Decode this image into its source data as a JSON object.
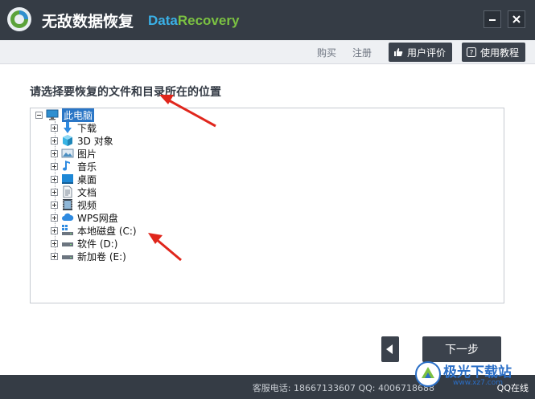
{
  "app": {
    "title": "无敌数据恢复",
    "brand_a": "Data",
    "brand_b": "Recovery"
  },
  "window": {
    "minimize": "—",
    "close": "✕"
  },
  "menu": {
    "buy": "购买",
    "register": "注册",
    "review_btn": "用户评价",
    "tutorial_btn": "使用教程"
  },
  "prompt": "请选择要恢复的文件和目录所在的位置",
  "tree": {
    "root": "此电脑",
    "items": [
      {
        "label": "下载",
        "icon": "download-arrow-icon"
      },
      {
        "label": "3D 对象",
        "icon": "3d-cube-icon"
      },
      {
        "label": "图片",
        "icon": "pictures-icon"
      },
      {
        "label": "音乐",
        "icon": "music-note-icon"
      },
      {
        "label": "桌面",
        "icon": "desktop-icon"
      },
      {
        "label": "文档",
        "icon": "document-icon"
      },
      {
        "label": "视频",
        "icon": "video-icon"
      },
      {
        "label": "WPS网盘",
        "icon": "cloud-icon"
      },
      {
        "label": "本地磁盘 (C:)",
        "icon": "system-drive-icon"
      },
      {
        "label": "软件 (D:)",
        "icon": "drive-icon"
      },
      {
        "label": "新加卷 (E:)",
        "icon": "drive-icon"
      }
    ]
  },
  "buttons": {
    "back": "◀",
    "next": "下一步"
  },
  "footer": {
    "hotline": "客服电话: 18667133607 QQ: 4006718688",
    "qq_online": "QQ在线"
  },
  "watermark": {
    "text": "极光下载站",
    "url": "www.xz7.com"
  },
  "colors": {
    "titlebar": "#353c45",
    "selection": "#2a76c6",
    "annotation_arrow": "#e0261c",
    "brand_data": "#3ab0e6",
    "brand_recovery": "#7bc142"
  }
}
